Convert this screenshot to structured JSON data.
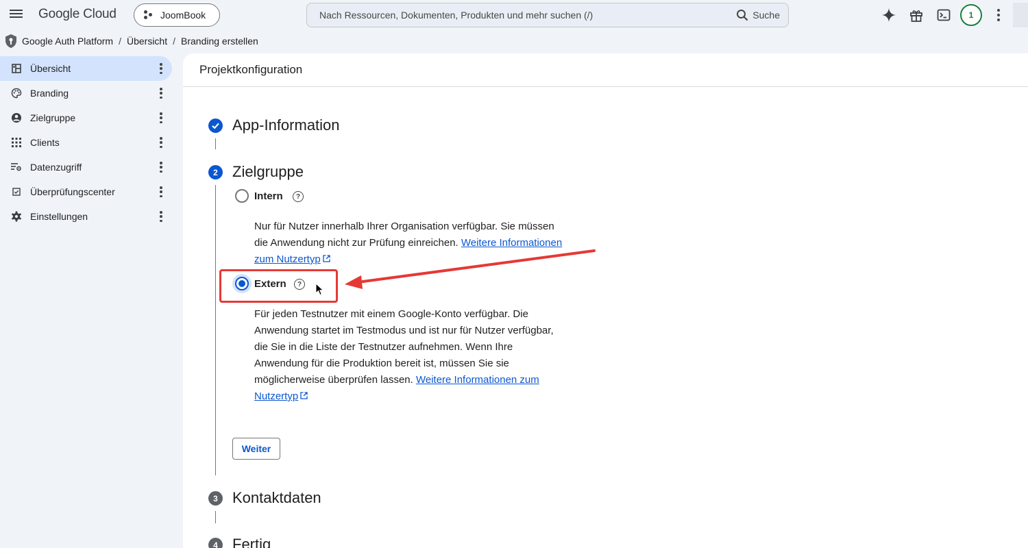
{
  "app": {
    "logo": "Google Cloud",
    "project_chip": "JoomBook",
    "search_placeholder": "Nach Ressourcen, Dokumenten, Produkten und mehr suchen (/)",
    "search_button": "Suche",
    "avatar_initial": "1"
  },
  "breadcrumb": [
    "Google Auth Platform",
    "Übersicht",
    "Branding erstellen"
  ],
  "sidebar": {
    "items": [
      {
        "label": "Übersicht",
        "icon": "dashboard-icon",
        "active": true
      },
      {
        "label": "Branding",
        "icon": "palette-icon",
        "active": false
      },
      {
        "label": "Zielgruppe",
        "icon": "account-circle-icon",
        "active": false
      },
      {
        "label": "Clients",
        "icon": "apps-grid-icon",
        "active": false
      },
      {
        "label": "Datenzugriff",
        "icon": "data-access-icon",
        "active": false
      },
      {
        "label": "Überprüfungscenter",
        "icon": "verification-icon",
        "active": false
      },
      {
        "label": "Einstellungen",
        "icon": "gear-icon",
        "active": false
      }
    ]
  },
  "main": {
    "header": "Projektkonfiguration",
    "steps": [
      {
        "number": "",
        "title": "App-Information",
        "status": "complete"
      },
      {
        "number": "2",
        "title": "Zielgruppe",
        "status": "active"
      },
      {
        "number": "3",
        "title": "Kontaktdaten",
        "status": "pending"
      },
      {
        "number": "4",
        "title": "Fertig",
        "status": "pending"
      }
    ],
    "options": {
      "intern": {
        "label": "Intern",
        "checked": false,
        "description": "Nur für Nutzer innerhalb Ihrer Organisation verfügbar. Sie müssen die Anwendung nicht zur Prüfung einreichen.",
        "link": "Weitere Informationen zum Nutzertyp"
      },
      "extern": {
        "label": "Extern",
        "checked": true,
        "description": "Für jeden Testnutzer mit einem Google-Konto verfügbar. Die Anwendung startet im Testmodus und ist nur für Nutzer verfügbar, die Sie in die Liste der Testnutzer aufnehmen. Wenn Ihre Anwendung für die Produktion bereit ist, müssen Sie sie möglicherweise überprüfen lassen.",
        "link": "Weitere Informationen zum Nutzertyp"
      }
    },
    "continue_button": "Weiter"
  },
  "colors": {
    "accent": "#0b57d0",
    "active_nav": "#d3e3fd",
    "step_pending": "#5f6368",
    "annotation": "#e53935",
    "avatar_ring": "#188038"
  }
}
